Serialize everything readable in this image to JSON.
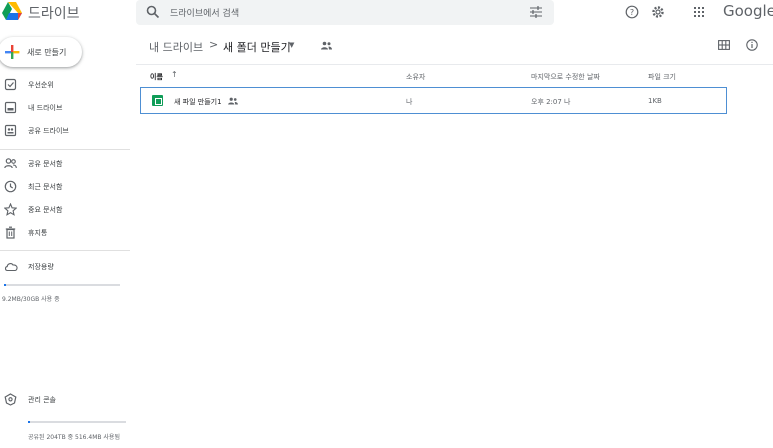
{
  "header": {
    "app_title": "드라이브",
    "search_placeholder": "드라이브에서 검색",
    "brand": "Google"
  },
  "sidebar": {
    "new_button_label": "새로 만들기",
    "items": [
      {
        "label": "우선순위",
        "icon": "check-square-icon"
      },
      {
        "label": "내 드라이브",
        "icon": "drive-icon"
      },
      {
        "label": "공유 드라이브",
        "icon": "shared-drive-icon"
      },
      {
        "label": "공유 문서함",
        "icon": "people-icon"
      },
      {
        "label": "최근 문서함",
        "icon": "clock-icon"
      },
      {
        "label": "중요 문서함",
        "icon": "star-icon"
      },
      {
        "label": "휴지통",
        "icon": "trash-icon"
      },
      {
        "label": "저장용량",
        "icon": "cloud-icon"
      }
    ],
    "storage_text": "9.2MB/30GB 사용 중",
    "storage_fraction": 0.003,
    "admin_label": "관리 콘솔",
    "shared_storage_text": "공유된 204TB 중 516.4MB 사용됨",
    "shared_storage_fraction": 0.003
  },
  "main": {
    "breadcrumb_root": "내 드라이브",
    "breadcrumb_separator": ">",
    "breadcrumb_current": "새 폴더 만들기",
    "columns": {
      "name": "이름",
      "owner": "소유자",
      "modified": "마지막으로 수정한 날짜",
      "size": "파일 크기"
    },
    "files": [
      {
        "name": "새 파일 만들기1",
        "owner": "나",
        "modified": "오후 2:07 나",
        "size": "1KB"
      }
    ]
  },
  "colors": {
    "accent": "#1a73e8",
    "sheets_green": "#0f9d58",
    "selected_border": "#4e8fd3"
  }
}
